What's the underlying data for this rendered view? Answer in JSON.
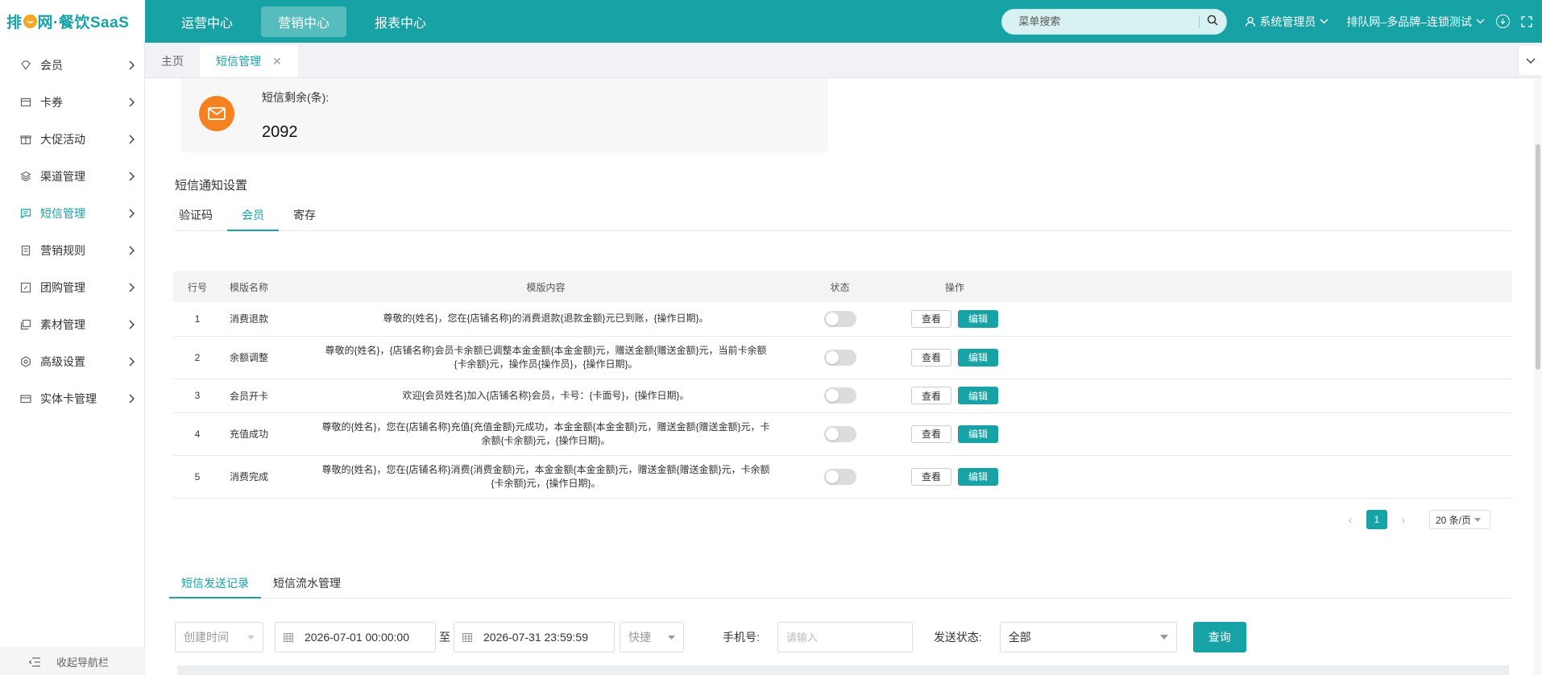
{
  "app": {
    "logo_text_a": "排队",
    "logo_text_b": "网·餐饮SaaS"
  },
  "topnav": {
    "items": [
      {
        "label": "运营中心"
      },
      {
        "label": "营销中心"
      },
      {
        "label": "报表中心"
      }
    ],
    "search_placeholder": "菜单搜索",
    "user": "系统管理员",
    "store": "排队网–多品牌–连锁测试"
  },
  "sidebar": {
    "items": [
      {
        "label": "会员"
      },
      {
        "label": "卡券"
      },
      {
        "label": "大促活动"
      },
      {
        "label": "渠道管理"
      },
      {
        "label": "短信管理"
      },
      {
        "label": "营销规则"
      },
      {
        "label": "团购管理"
      },
      {
        "label": "素材管理"
      },
      {
        "label": "高级设置"
      },
      {
        "label": "实体卡管理"
      }
    ],
    "collapse_label": "收起导航栏"
  },
  "page_tabs": [
    {
      "label": "主页"
    },
    {
      "label": "短信管理"
    }
  ],
  "sms_card": {
    "label": "短信剩余(条):",
    "count": "2092"
  },
  "notify_section": {
    "title": "短信通知设置",
    "tabs": [
      {
        "label": "验证码"
      },
      {
        "label": "会员"
      },
      {
        "label": "寄存"
      }
    ]
  },
  "table": {
    "headers": [
      "行号",
      "模版名称",
      "模版内容",
      "状态",
      "操作"
    ],
    "view_label": "查看",
    "edit_label": "编辑",
    "rows": [
      {
        "no": "1",
        "name": "消费退款",
        "content": "尊敬的{姓名}，您在{店铺名称}的消费退款{退款金额}元已到账，{操作日期}。"
      },
      {
        "no": "2",
        "name": "余额调整",
        "content": "尊敬的{姓名}，{店铺名称}会员卡余额已调整本金金额{本金金额}元，赠送金额{赠送金额}元，当前卡余额{卡余额}元，操作员{操作员}，{操作日期}。"
      },
      {
        "no": "3",
        "name": "会员开卡",
        "content": "欢迎{会员姓名}加入{店铺名称}会员，卡号：{卡面号}，{操作日期}。"
      },
      {
        "no": "4",
        "name": "充值成功",
        "content": "尊敬的{姓名}，您在{店铺名称}充值{充值金额}元成功，本金金额{本金金额}元，赠送金额{赠送金额}元，卡余额{卡余额}元，{操作日期}。"
      },
      {
        "no": "5",
        "name": "消费完成",
        "content": "尊敬的{姓名}，您在{店铺名称}消费{消费金额}元，本金金额{本金金额}元，赠送金额{赠送金额}元，卡余额{卡余额}元，{操作日期}。"
      }
    ]
  },
  "pagination": {
    "current_page": "1",
    "page_size": "20 条/页"
  },
  "log_tabs": [
    {
      "label": "短信发送记录"
    },
    {
      "label": "短信流水管理"
    }
  ],
  "filter": {
    "time_type": "创建时间",
    "start": "2026-07-01 00:00:00",
    "to": "至",
    "end": "2026-07-31 23:59:59",
    "quick": "快捷",
    "phone_label": "手机号:",
    "phone_placeholder": "请输入",
    "status_label": "发送状态:",
    "status_value": "全部",
    "query_label": "查询"
  },
  "colors": {
    "primary": "#17a2a6",
    "sms_icon": "#f5821f"
  }
}
